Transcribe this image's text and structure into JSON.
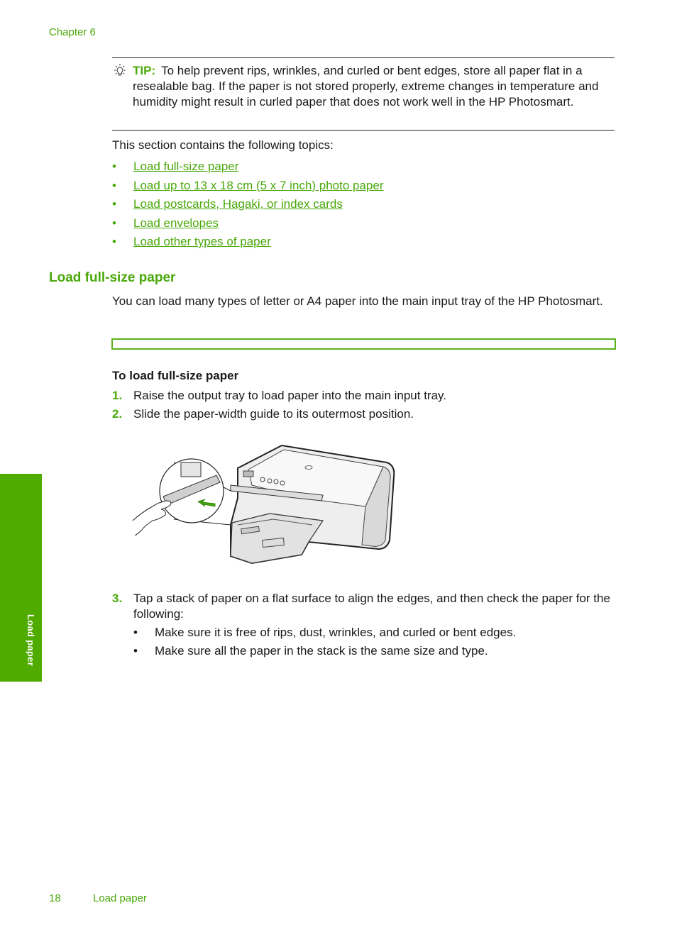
{
  "header": {
    "chapter": "Chapter 6"
  },
  "tip": {
    "icon": "lightbulb-icon",
    "label": "TIP:",
    "text": "To help prevent rips, wrinkles, and curled or bent edges, store all paper flat in a resealable bag. If the paper is not stored properly, extreme changes in temperature and humidity might result in curled paper that does not work well in the HP Photosmart."
  },
  "intro": "This section contains the following topics:",
  "topics": [
    {
      "label": "Load full-size paper"
    },
    {
      "label": "Load up to 13 x 18 cm (5 x 7 inch) photo paper"
    },
    {
      "label": "Load postcards, Hagaki, or index cards"
    },
    {
      "label": "Load envelopes"
    },
    {
      "label": "Load other types of paper"
    }
  ],
  "section": {
    "heading": "Load full-size paper",
    "paragraph": "You can load many types of letter or A4 paper into the main input tray of the HP Photosmart.",
    "procedure_title": "To load full-size paper",
    "steps": [
      {
        "num": "1.",
        "text": "Raise the output tray to load paper into the main input tray."
      },
      {
        "num": "2.",
        "text": "Slide the paper-width guide to its outermost position."
      },
      {
        "num": "3.",
        "text": "Tap a stack of paper on a flat surface to align the edges, and then check the paper for the following:"
      }
    ],
    "step3_bullets": [
      "Make sure it is free of rips, dust, wrinkles, and curled or bent edges.",
      "Make sure all the paper in the stack is the same size and type."
    ],
    "illustration": "printer-paper-width-guide-illustration"
  },
  "side_tab": {
    "label": "Load paper",
    "color": "#4fab00"
  },
  "footer": {
    "page_number": "18",
    "title": "Load paper"
  },
  "colors": {
    "accent": "#4aa80a",
    "text": "#1a1a1a"
  }
}
